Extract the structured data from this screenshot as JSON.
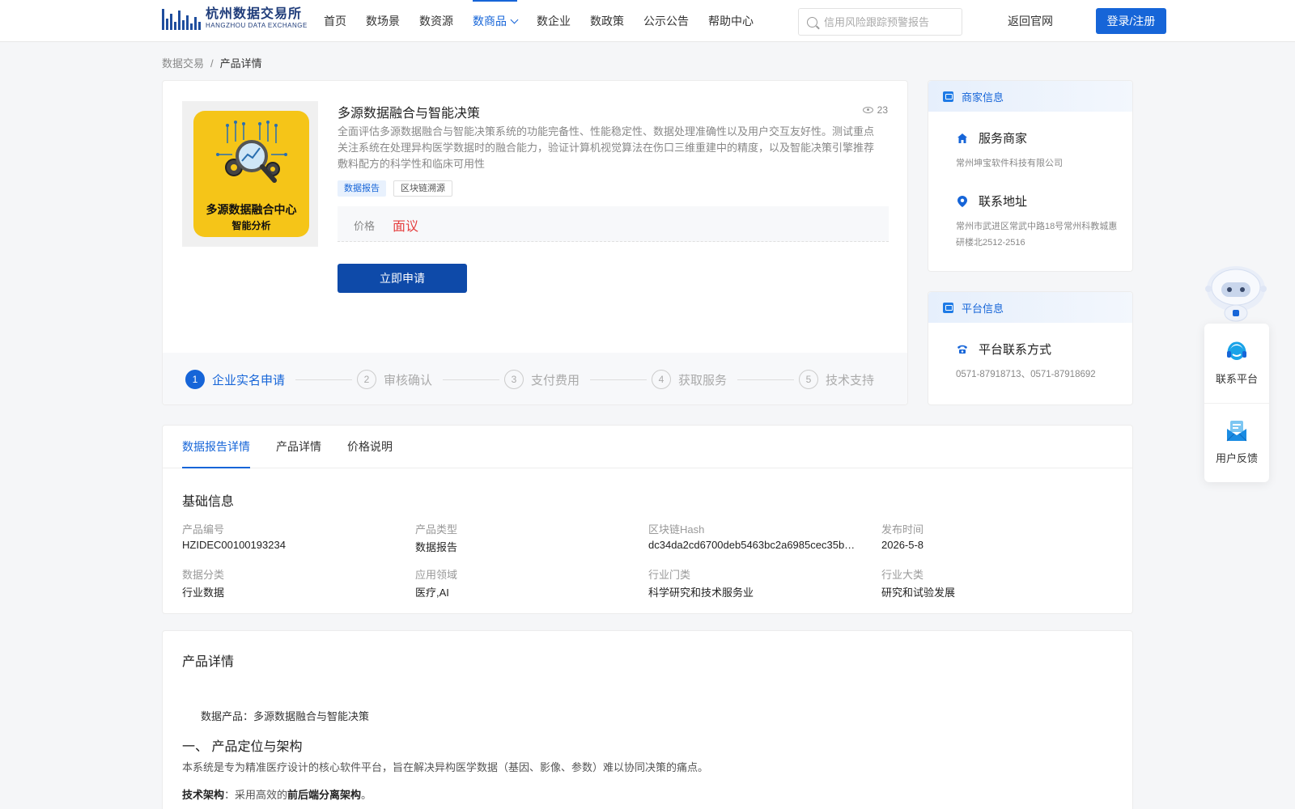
{
  "header": {
    "logo_cn": "杭州数据交易所",
    "logo_en": "HANGZHOU DATA EXCHANGE",
    "nav": [
      "首页",
      "数场景",
      "数资源",
      "数商品",
      "数企业",
      "数政策",
      "公示公告",
      "帮助中心"
    ],
    "active_nav": "数商品",
    "search_placeholder": "信用风险跟踪预警报告",
    "back_link": "返回官网",
    "login": "登录/注册"
  },
  "breadcrumb": {
    "root": "数据交易",
    "sep": "/",
    "current": "产品详情"
  },
  "product": {
    "image_title": "多源数据融合中心",
    "image_subtitle": "智能分析",
    "title": "多源数据融合与智能决策",
    "views": "23",
    "description": "全面评估多源数据融合与智能决策系统的功能完备性、性能稳定性、数据处理准确性以及用户交互友好性。测试重点关注系统在处理异构医学数据时的融合能力，验证计算机视觉算法在伤口三维重建中的精度，以及智能决策引擎推荐敷料配方的科学性和临床可用性",
    "tags": [
      "数据报告",
      "区块链溯源"
    ],
    "price_label": "价格",
    "price_value": "面议",
    "apply_button": "立即申请",
    "steps": [
      {
        "num": "1",
        "label": "企业实名申请"
      },
      {
        "num": "2",
        "label": "审核确认"
      },
      {
        "num": "3",
        "label": "支付费用"
      },
      {
        "num": "4",
        "label": "获取服务"
      },
      {
        "num": "5",
        "label": "技术支持"
      }
    ]
  },
  "merchant": {
    "header": "商家信息",
    "service_title": "服务商家",
    "service_value": "常州坤宝软件科技有限公司",
    "address_title": "联系地址",
    "address_value": "常州市武进区常武中路18号常州科教城惠研楼北2512-2516"
  },
  "platform": {
    "header": "平台信息",
    "contact_title": "平台联系方式",
    "contact_value": "0571-87918713、0571-87918692"
  },
  "float_widgets": {
    "contact": "联系平台",
    "feedback": "用户反馈"
  },
  "detail_tabs": [
    "数据报告详情",
    "产品详情",
    "价格说明"
  ],
  "basic_info": {
    "title": "基础信息",
    "fields": [
      {
        "label": "产品编号",
        "value": "HZIDEC00100193234"
      },
      {
        "label": "产品类型",
        "value": "数据报告"
      },
      {
        "label": "区块链Hash",
        "value": "dc34da2cd6700deb5463bc2a6985cec35b…"
      },
      {
        "label": "发布时间",
        "value": "2026-5-8"
      },
      {
        "label": "数据分类",
        "value": "行业数据"
      },
      {
        "label": "应用领域",
        "value": "医疗,AI"
      },
      {
        "label": "行业门类",
        "value": "科学研究和技术服务业"
      },
      {
        "label": "行业大类",
        "value": "研究和试验发展"
      }
    ]
  },
  "product_detail": {
    "title": "产品详情",
    "line1": "数据产品：多源数据融合与智能决策",
    "heading": "一、 产品定位与架构",
    "line2": "本系统是专为精准医疗设计的核心软件平台，旨在解决异构医学数据（基因、影像、参数）难以协同决策的痛点。",
    "line3_bold1": "技术架构",
    "line3_mid": "：采用高效的",
    "line3_bold2": "前后端分离架构",
    "line3_end": "。"
  }
}
